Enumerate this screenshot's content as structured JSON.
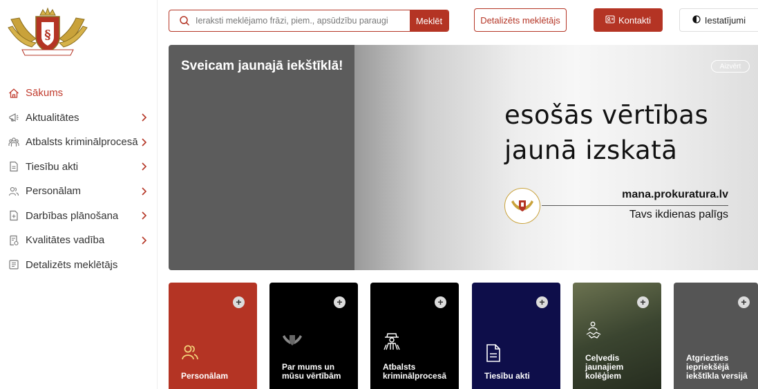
{
  "header": {
    "search_placeholder": "Ieraksti meklējamo frāzi, piem., apsūdzību paraugi",
    "search_button": "Meklēt",
    "advanced_search": "Detalizēts meklētājs",
    "contacts": "Kontakti",
    "settings": "Iestatījumi"
  },
  "logo": {
    "motto": "DURA LEX, SED LEX"
  },
  "sidebar": {
    "items": [
      {
        "label": "Sākums",
        "icon": "home-icon",
        "active": true,
        "has_submenu": false
      },
      {
        "label": "Aktualitātes",
        "icon": "megaphone-icon",
        "active": false,
        "has_submenu": true
      },
      {
        "label": "Atbalsts kriminālprocesā",
        "icon": "people-icon",
        "active": false,
        "has_submenu": true
      },
      {
        "label": "Tiesību akti",
        "icon": "document-icon",
        "active": false,
        "has_submenu": true
      },
      {
        "label": "Personālam",
        "icon": "users-icon",
        "active": false,
        "has_submenu": true
      },
      {
        "label": "Darbības plānošana",
        "icon": "plan-document-icon",
        "active": false,
        "has_submenu": true
      },
      {
        "label": "Kvalitātes vadība",
        "icon": "quality-document-icon",
        "active": false,
        "has_submenu": true
      },
      {
        "label": "Detalizēts meklētājs",
        "icon": "search-list-icon",
        "active": false,
        "has_submenu": false
      }
    ]
  },
  "banner": {
    "welcome": "Sveicam jaunajā iekštīklā!",
    "close": "Aizvērt",
    "headline_line1": "esošās vērtības",
    "headline_line2": "jaunā izskatā",
    "site": "mana.prokuratura.lv",
    "tagline": "Tavs ikdienas palīgs"
  },
  "tiles": [
    {
      "label": "Personālam",
      "icon": "users-icon",
      "bg": "#b43424"
    },
    {
      "label": "Par mums un mūsu vērtībām",
      "icon": "emblem-icon",
      "bg": "#000000"
    },
    {
      "label": "Atbalsts kriminālprocesā",
      "icon": "detective-icon",
      "bg": "#000000"
    },
    {
      "label": "Tiesību akti",
      "icon": "document-icon",
      "bg": "#0e0e4a"
    },
    {
      "label": "Ceļvedis jaunajiem kolēģiem",
      "icon": "handshake-icon",
      "bg": "#4f5a3c"
    },
    {
      "label": "Atgriezties iepriekšējā iekštīkla versijā",
      "icon": "return-icon",
      "bg": "#555555"
    }
  ],
  "colors": {
    "accent": "#b43424",
    "banner_dark": "#5c5c5c"
  }
}
